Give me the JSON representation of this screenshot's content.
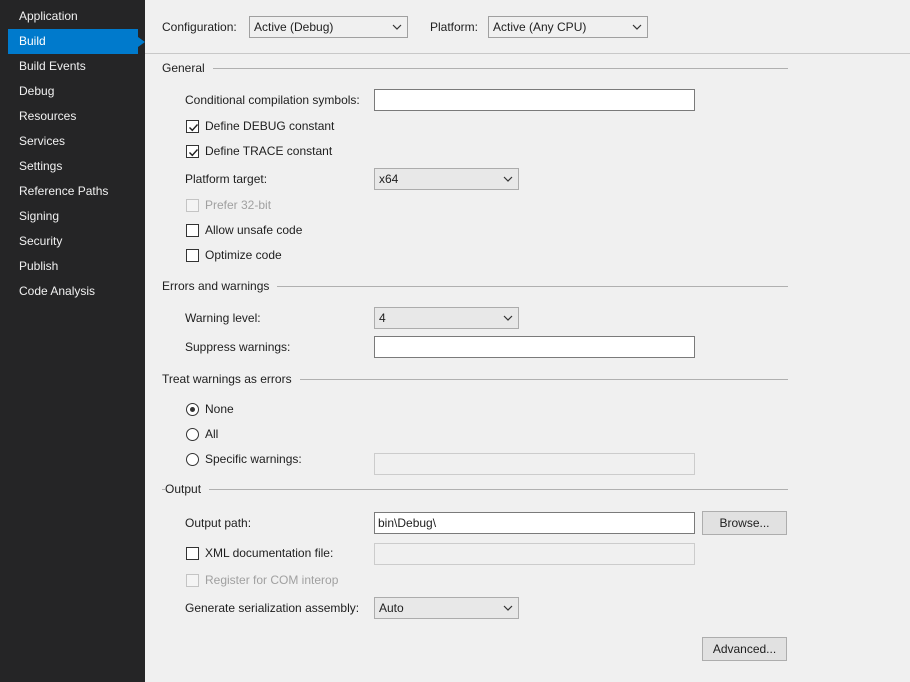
{
  "sidebar": {
    "items": [
      {
        "label": "Application"
      },
      {
        "label": "Build"
      },
      {
        "label": "Build Events"
      },
      {
        "label": "Debug"
      },
      {
        "label": "Resources"
      },
      {
        "label": "Services"
      },
      {
        "label": "Settings"
      },
      {
        "label": "Reference Paths"
      },
      {
        "label": "Signing"
      },
      {
        "label": "Security"
      },
      {
        "label": "Publish"
      },
      {
        "label": "Code Analysis"
      }
    ],
    "active": "Build"
  },
  "header": {
    "configuration_label": "Configuration:",
    "configuration_value": "Active (Debug)",
    "platform_label": "Platform:",
    "platform_value": "Active (Any CPU)"
  },
  "general": {
    "title": "General",
    "symbols_label": "Conditional compilation symbols:",
    "symbols_value": "",
    "debug_constant": {
      "label": "Define DEBUG constant",
      "checked": true
    },
    "trace_constant": {
      "label": "Define TRACE constant",
      "checked": true
    },
    "platform_target_label": "Platform target:",
    "platform_target_value": "x64",
    "prefer32": {
      "label": "Prefer 32-bit",
      "checked": false,
      "enabled": false
    },
    "unsafe_code": {
      "label": "Allow unsafe code",
      "checked": false
    },
    "optimize_code": {
      "label": "Optimize code",
      "checked": false
    }
  },
  "errors": {
    "title": "Errors and warnings",
    "warning_level_label": "Warning level:",
    "warning_level_value": "4",
    "suppress_label": "Suppress warnings:",
    "suppress_value": ""
  },
  "treat": {
    "title": "Treat warnings as errors",
    "none_label": "None",
    "all_label": "All",
    "specific_label": "Specific warnings:",
    "selected": "None",
    "specific_value": ""
  },
  "output": {
    "title": "Output",
    "path_label": "Output path:",
    "path_value": "bin\\Debug\\",
    "browse_label": "Browse...",
    "xml_doc": {
      "label": "XML documentation file:",
      "checked": false
    },
    "xml_doc_value": "",
    "com_interop": {
      "label": "Register for COM interop",
      "checked": false,
      "enabled": false
    },
    "serialization_label": "Generate serialization assembly:",
    "serialization_value": "Auto",
    "advanced_label": "Advanced..."
  },
  "icons": {
    "caret": "chevron-down-icon",
    "check": "checkmark-icon"
  },
  "colors": {
    "sidebar_bg": "#252526",
    "accent": "#007acc",
    "page_bg": "#f0f0f0"
  }
}
